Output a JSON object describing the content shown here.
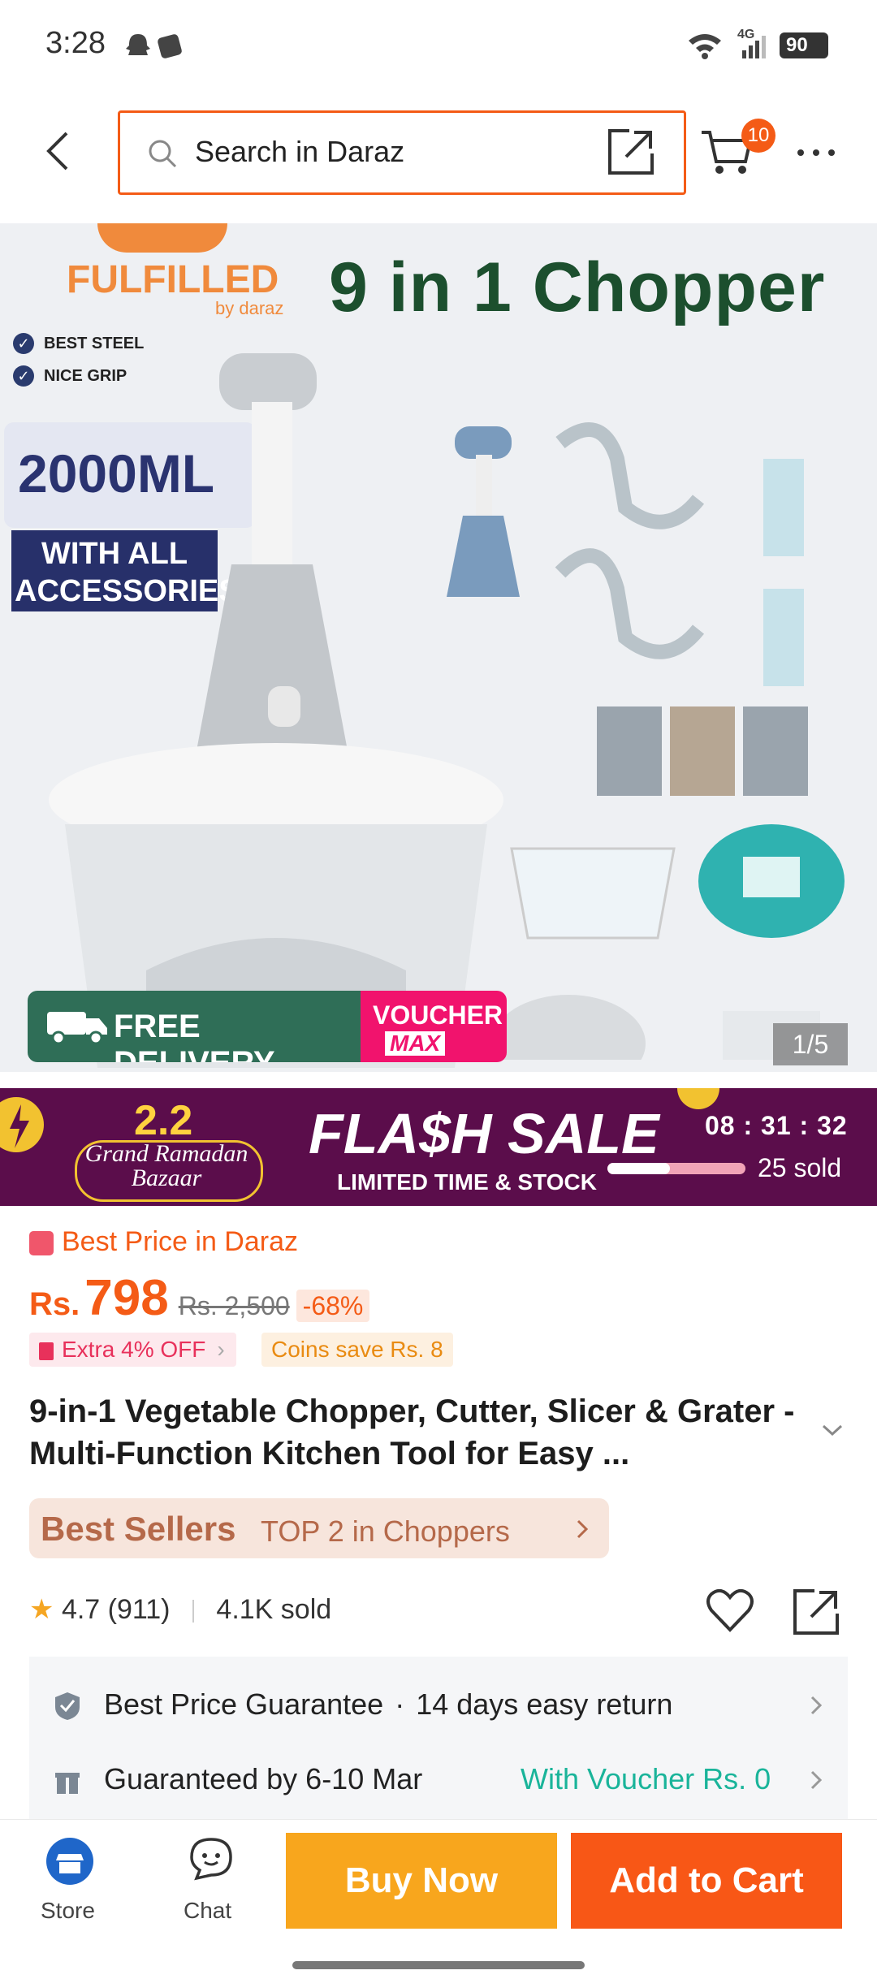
{
  "status_bar": {
    "time": "3:28",
    "battery": "90",
    "network": "4G"
  },
  "header": {
    "search_placeholder": "Search in Daraz",
    "cart_count": "10"
  },
  "hero": {
    "brand_badge": "FULFILLED",
    "brand_by": "by daraz",
    "title": "9 in 1 Chopper",
    "features": [
      "BEST STEEL",
      "NICE GRIP"
    ],
    "capacity": "2000ML",
    "accessories": "WITH ALL ACCESSORIES",
    "free_delivery": "FREE DELIVERY",
    "voucher": "VOUCHER",
    "voucher_max": "MAX",
    "counter": "1/5"
  },
  "flash_sale": {
    "event_number": "2.2",
    "event_name": "Grand Ramadan Bazaar",
    "title": "FLA$H SALE",
    "subtitle": "LIMITED TIME & STOCK",
    "timer": "08 : 31 : 32",
    "sold": "25 sold",
    "progress": 0.45
  },
  "product": {
    "best_price": "Best Price in Daraz",
    "currency": "Rs.",
    "price": "798",
    "old_price": "Rs. 2,500",
    "discount": "-68%",
    "extra_off": "Extra 4% OFF",
    "coins": "Coins save Rs. 8",
    "title": "9-in-1 Vegetable Chopper, Cutter, Slicer & Grater - Multi-Function Kitchen Tool for Easy ...",
    "best_sellers": "Best Sellers",
    "rank": "TOP 2 in Choppers",
    "rating": "4.7",
    "reviews": "(911)",
    "sold": "4.1K sold"
  },
  "info": {
    "guarantee": "Best Price Guarantee",
    "returns": "14 days easy return",
    "delivery": "Guaranteed by 6-10 Mar",
    "voucher": "With Voucher Rs. 0"
  },
  "bottom_bar": {
    "store": "Store",
    "chat": "Chat",
    "buy_now": "Buy Now",
    "add_to_cart": "Add to Cart"
  },
  "colors": {
    "brand_orange": "#f45b16",
    "buy_now": "#f8a61d",
    "add_to_cart": "#f85716",
    "flash_bg": "#5b0d4b",
    "voucher_green": "#1ab49a"
  }
}
